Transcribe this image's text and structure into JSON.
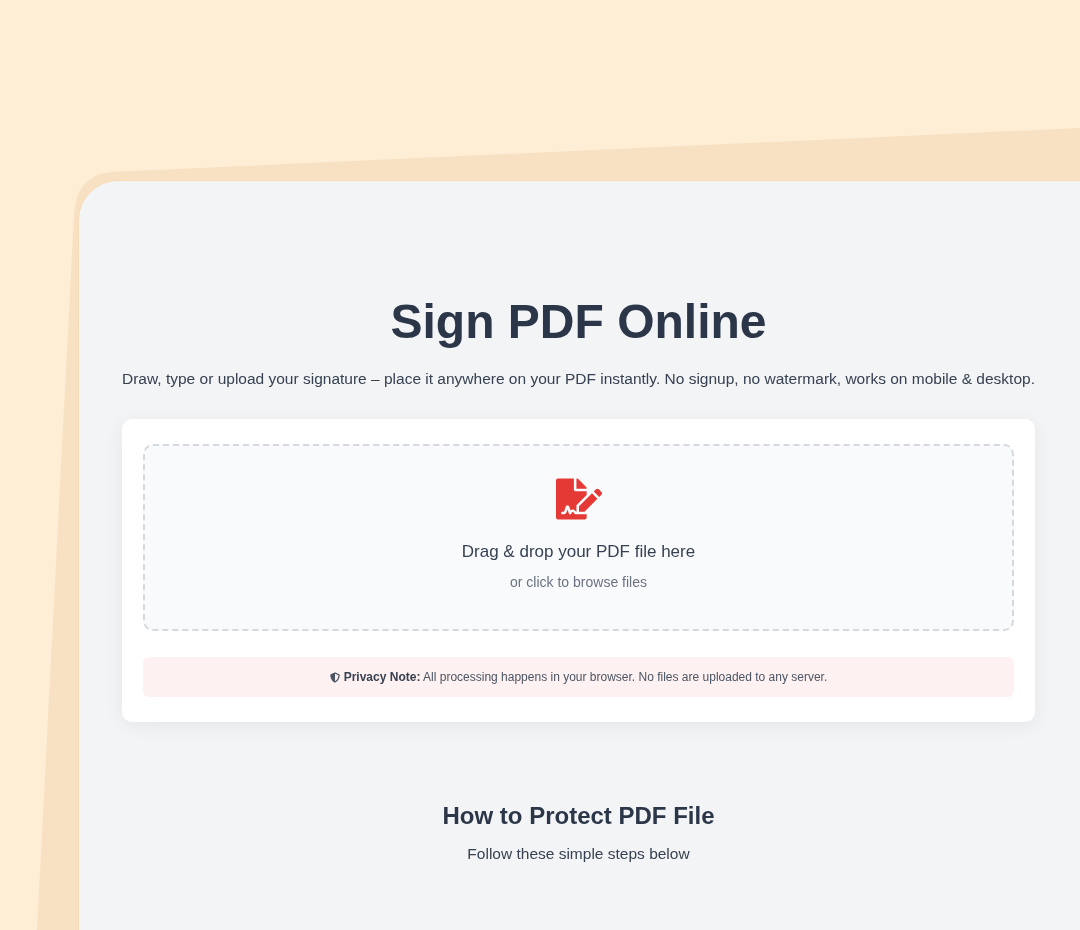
{
  "hero": {
    "title": "Sign PDF Online",
    "subtitle": "Draw, type or upload your signature – place it anywhere on your PDF instantly. No signup, no watermark, works on mobile & desktop."
  },
  "upload": {
    "prompt": "Drag & drop your PDF file here",
    "hint": "or click to browse files"
  },
  "privacy_note": "**Privacy Note:** All processing happens in your browser. No files are uploaded to any server.",
  "steps_section": {
    "title": "How to Protect PDF File",
    "subtitle": "Follow these simple steps below"
  }
}
